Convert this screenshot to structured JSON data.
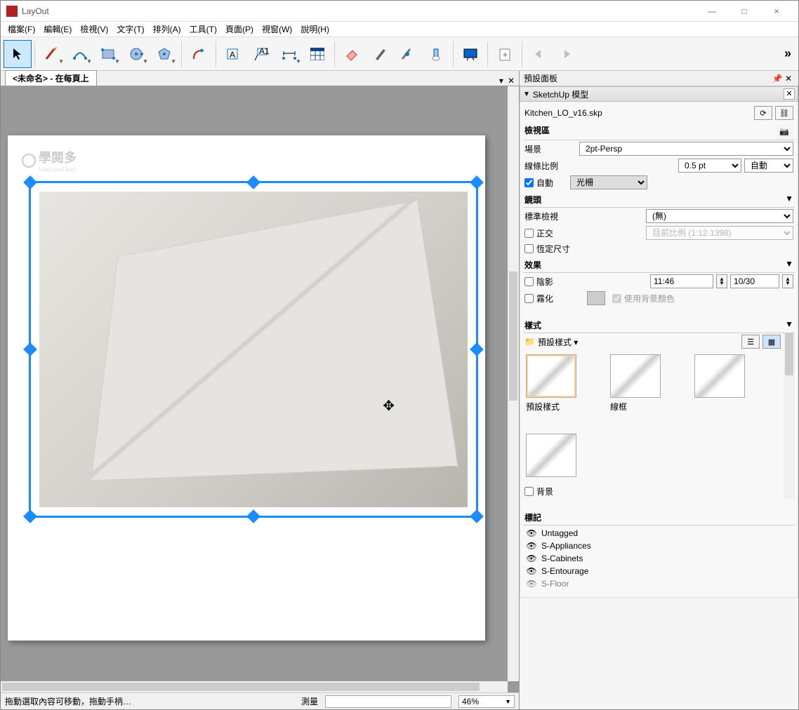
{
  "window": {
    "title": "LayOut",
    "minimize": "—",
    "maximize": "□",
    "close": "×"
  },
  "menu": {
    "file": "檔案(F)",
    "edit": "編輯(E)",
    "view": "檢視(V)",
    "text": "文字(T)",
    "arrange": "排列(A)",
    "tools": "工具(T)",
    "page": "頁面(P)",
    "window": "視窗(W)",
    "help": "說明(H)"
  },
  "doc_tab": "<未命名> - 在每頁上",
  "watermark": {
    "name": "學閱多",
    "sub": "Learn and live!"
  },
  "statusbar": {
    "hint": "拖動選取內容可移動，拖動手柄…",
    "measure_label": "測量",
    "zoom": "46%"
  },
  "panel": {
    "title": "預設面板",
    "sketchup_model": "SketchUp 模型",
    "model_file": "Kitchen_LO_v16.skp",
    "viewport_hdr": "檢視區",
    "scene_label": "場景",
    "scene_value": "2pt-Persp",
    "line_scale_label": "線條比例",
    "line_scale_value": "0.5 pt",
    "line_scale_mode": "自動",
    "auto_label": "自動",
    "raster_label": "光柵",
    "camera_hdr": "鏡頭",
    "std_view_label": "標準檢視",
    "std_view_value": "(無)",
    "ortho_label": "正交",
    "ortho_scale": "目前比例 (1:12.1398)",
    "preserve_label": "恆定尺寸",
    "effects_hdr": "效果",
    "shadow_label": "陰影",
    "shadow_time": "11:46",
    "shadow_date": "10/30",
    "fog_label": "霧化",
    "fog_bg_label": "使用背景顏色",
    "styles_hdr": "樣式",
    "styles_dropdown": "預設樣式",
    "style1": "預設樣式",
    "style2": "線框",
    "bg_label": "背景",
    "tags_hdr": "標記",
    "tags": [
      "Untagged",
      "S-Appliances",
      "S-Cabinets",
      "S-Entourage",
      "S-Floor"
    ]
  }
}
